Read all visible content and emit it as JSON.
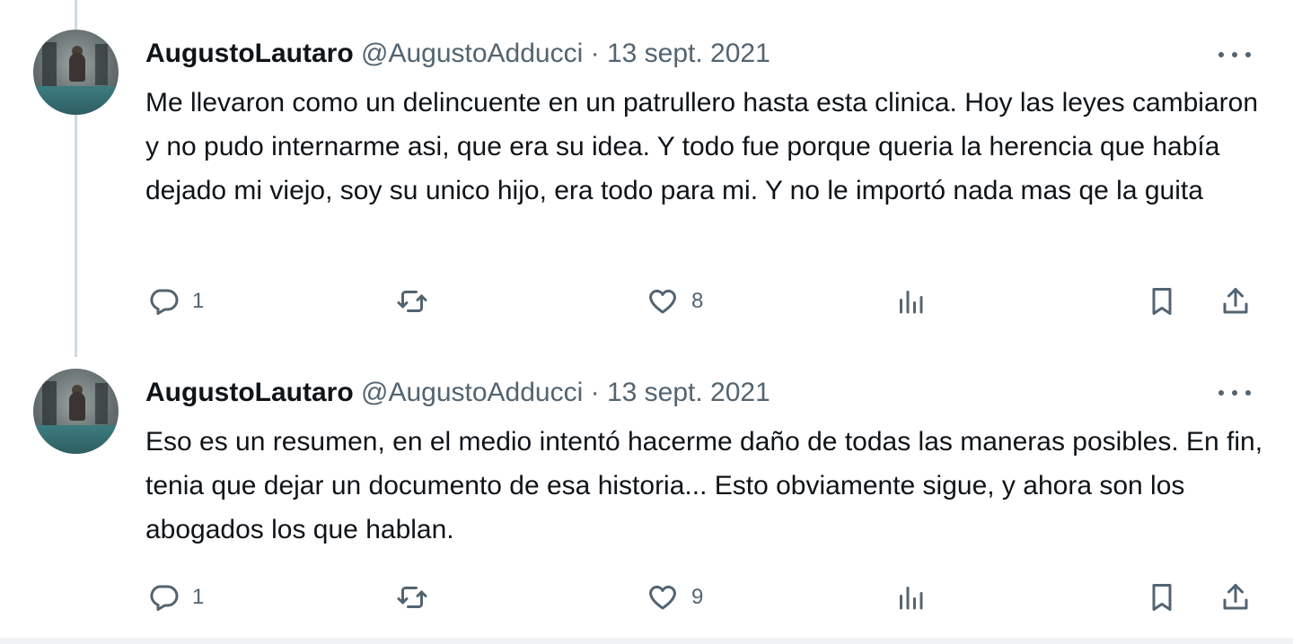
{
  "tweets": [
    {
      "display_name": "AugustoLautaro",
      "handle": "@AugustoAdducci",
      "separator": "·",
      "date": "13 sept. 2021",
      "text": "Me llevaron como un delincuente en un patrullero hasta esta clinica. Hoy las leyes cambiaron y no pudo internarme asi, que era su idea. Y todo fue porque queria la herencia que había dejado mi viejo, soy su unico hijo, era todo para mi. Y no le importó nada mas qe la guita",
      "replies": "1",
      "retweets": "",
      "likes": "8",
      "views": ""
    },
    {
      "display_name": "AugustoLautaro",
      "handle": "@AugustoAdducci",
      "separator": "·",
      "date": "13 sept. 2021",
      "text": "Eso es un resumen, en el medio intentó hacerme daño de todas las maneras posibles. En fin, tenia que dejar un documento de esa historia... Esto obviamente sigue,  y ahora son los abogados los que hablan.",
      "replies": "1",
      "retweets": "",
      "likes": "9",
      "views": ""
    }
  ],
  "icons": {
    "more": "more-dots-icon",
    "reply": "reply-bubble-icon",
    "retweet": "retweet-arrows-icon",
    "like": "heart-icon",
    "views": "views-bar-chart-icon",
    "bookmark": "bookmark-icon",
    "share": "share-upload-icon"
  },
  "colors": {
    "text_primary": "#0f1419",
    "text_secondary": "#536471",
    "thread_line": "#cfd9de"
  }
}
